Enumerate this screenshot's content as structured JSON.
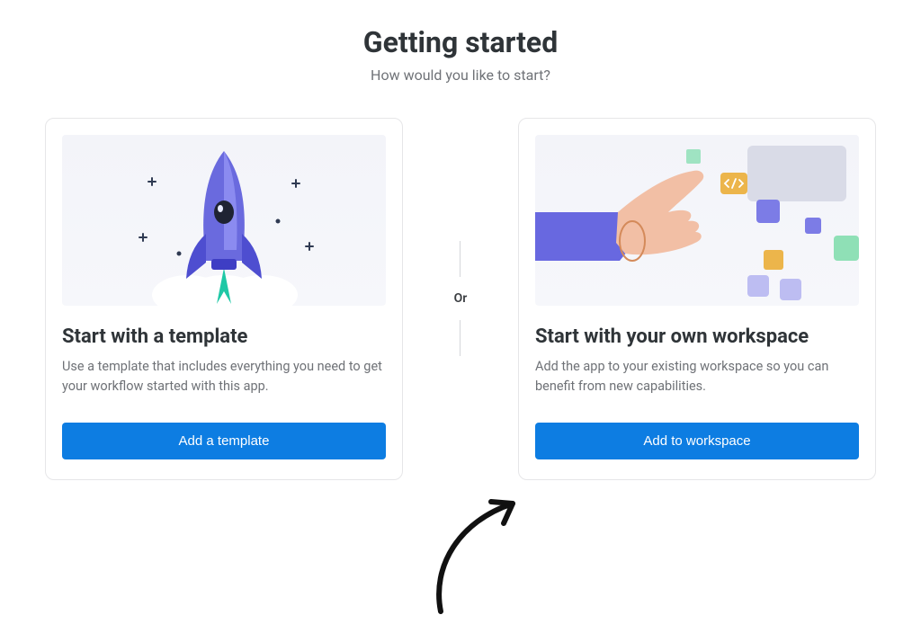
{
  "heading": {
    "title": "Getting started",
    "subtitle": "How would you like to start?"
  },
  "cards": {
    "template": {
      "title": "Start with a template",
      "description": "Use a template that includes everything you need to get your workflow started with this app.",
      "button": "Add a template"
    },
    "workspace": {
      "title": "Start with your own workspace",
      "description": "Add the app to your existing workspace so you can benefit from new capabilities.",
      "button": "Add to workspace"
    }
  },
  "divider": {
    "label": "Or"
  }
}
